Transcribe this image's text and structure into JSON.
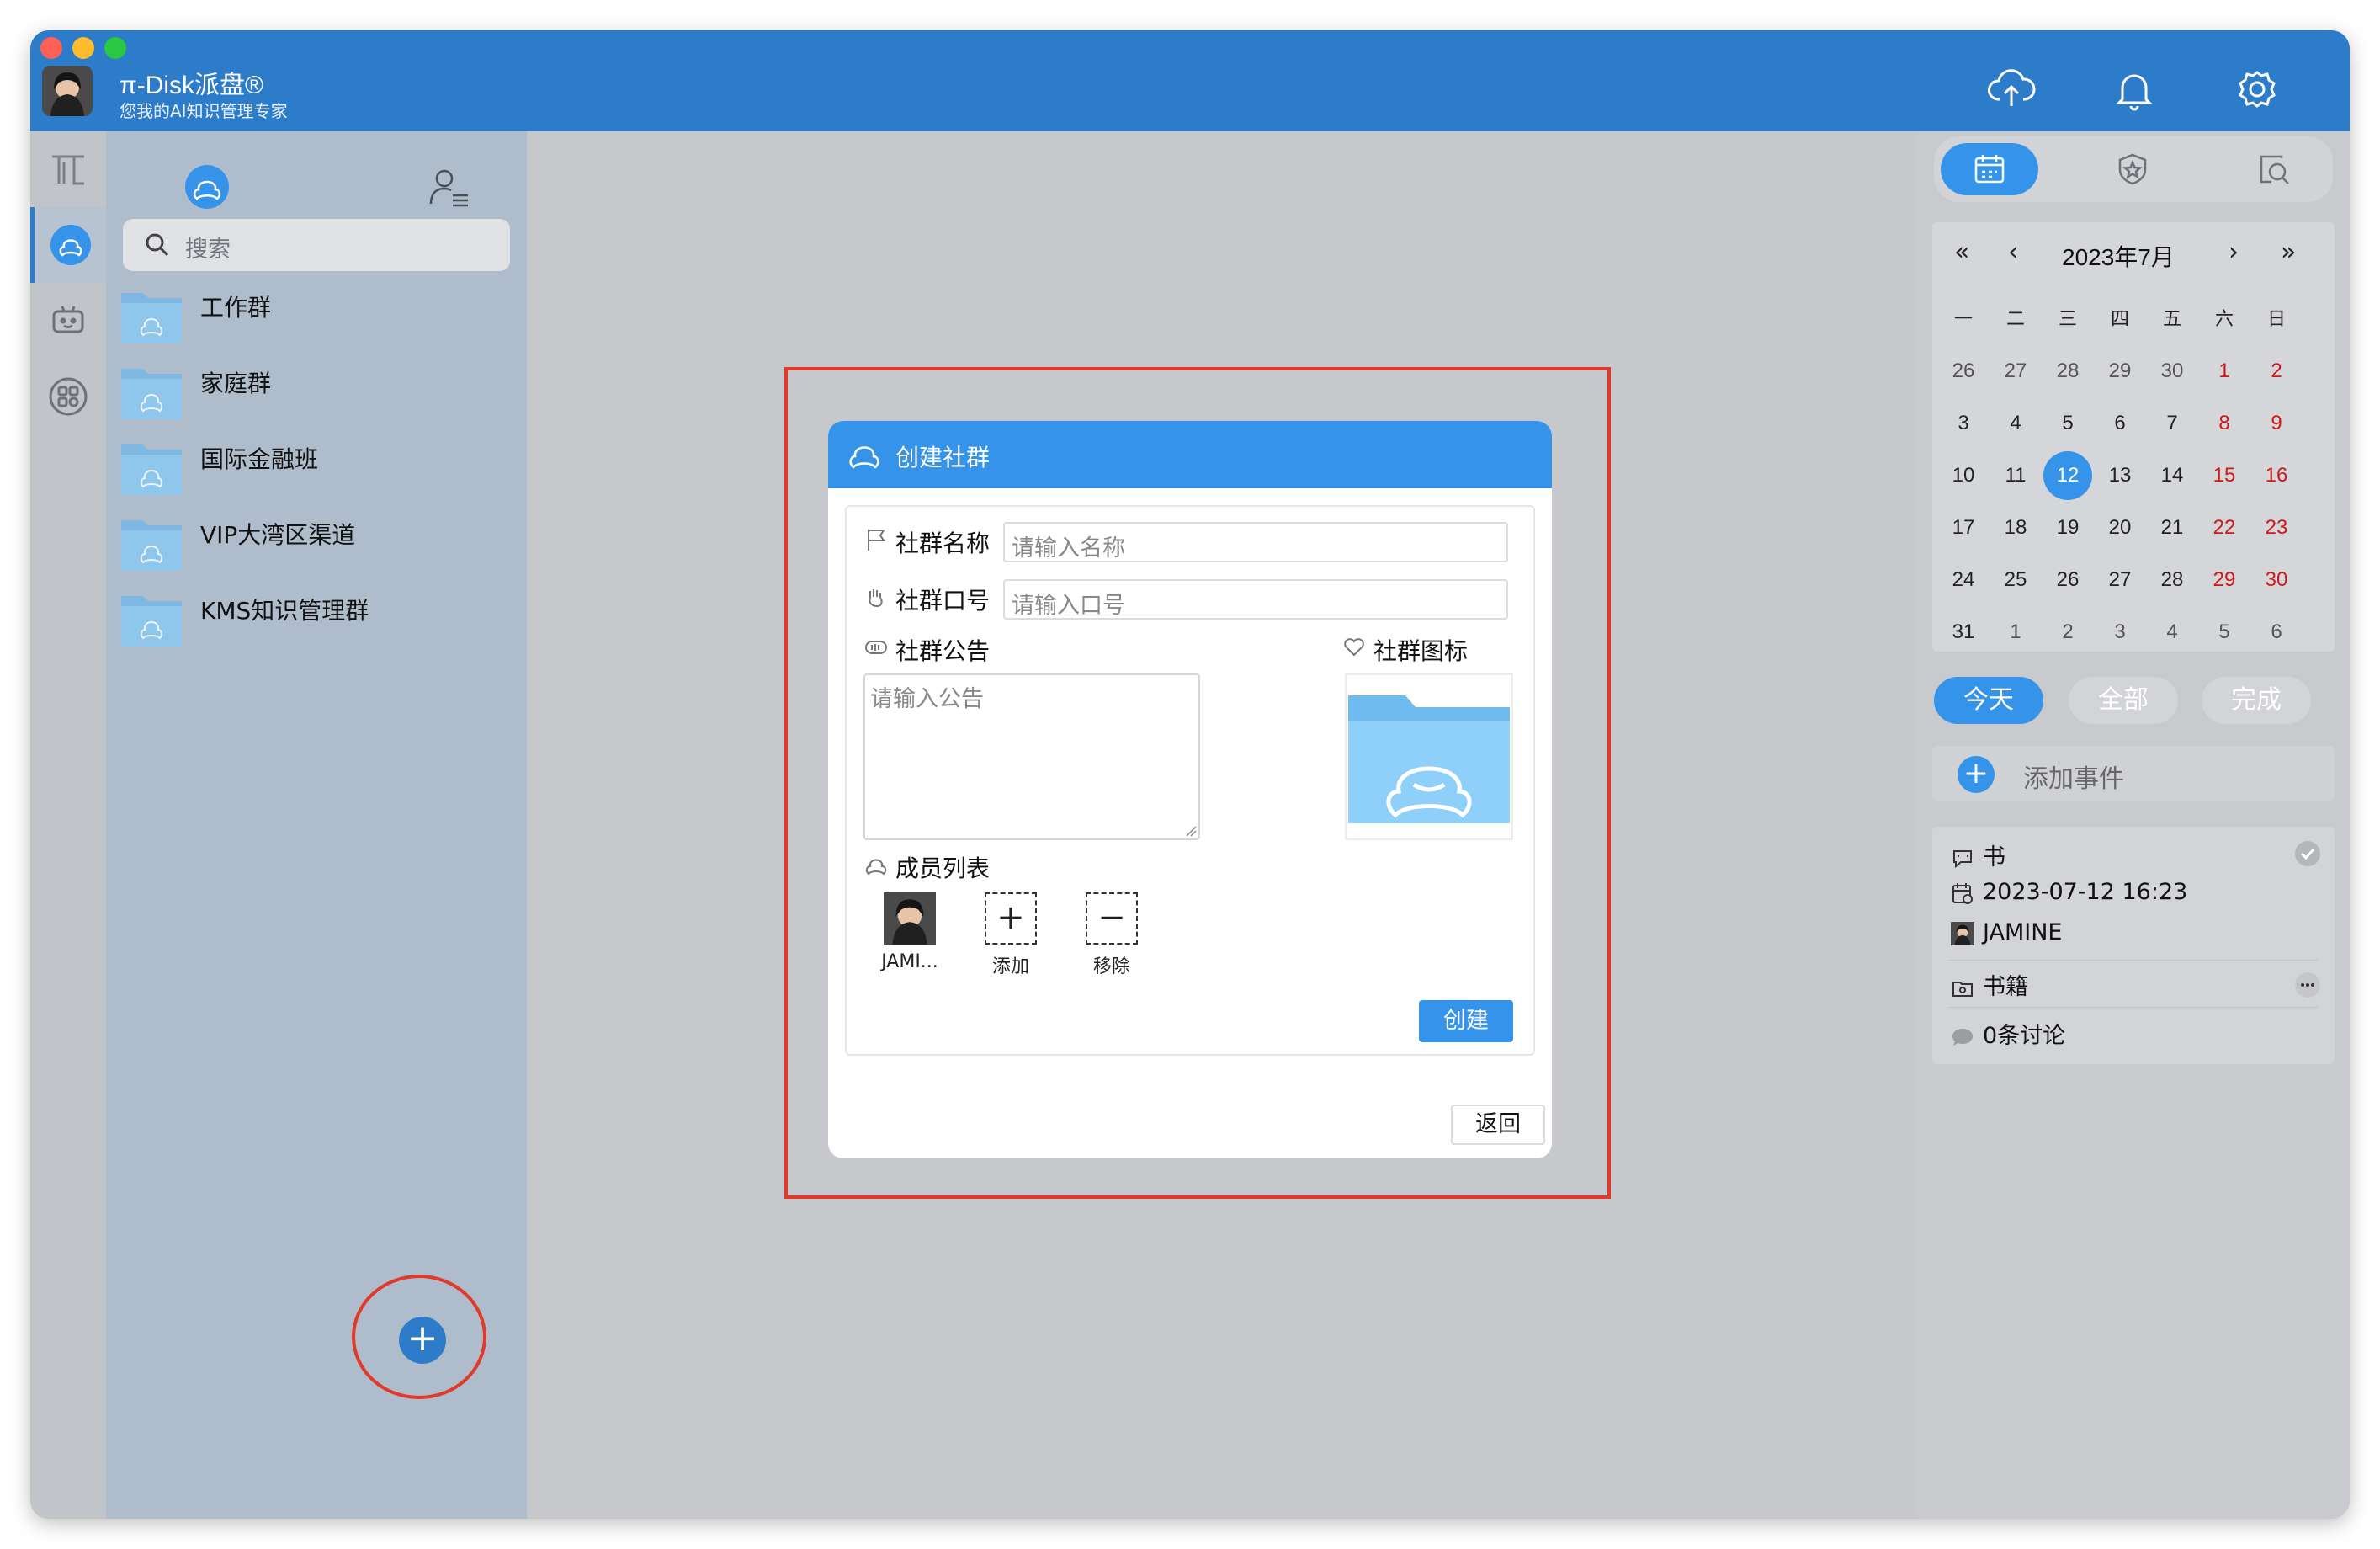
{
  "app": {
    "title": "π-Disk派盘®",
    "subtitle": "您我的AI知识管理专家"
  },
  "list": {
    "search_placeholder": "搜索",
    "groups": [
      "工作群",
      "家庭群",
      "国际金融班",
      "VIP大湾区渠道",
      "KMS知识管理群"
    ]
  },
  "dialog": {
    "title": "创建社群",
    "name_label": "社群名称",
    "name_placeholder": "请输入名称",
    "code_label": "社群口号",
    "code_placeholder": "请输入口号",
    "notice_label": "社群公告",
    "notice_placeholder": "请输入公告",
    "icon_label": "社群图标",
    "members_label": "成员列表",
    "member_name": "JAMI...",
    "add_label": "添加",
    "remove_label": "移除",
    "create_button": "创建",
    "back_button": "返回"
  },
  "calendar": {
    "month_label": "2023年7月",
    "nav": {
      "prev_year": "«",
      "prev_month": "‹",
      "next_month": "›",
      "next_year": "»"
    },
    "weekdays": [
      "一",
      "二",
      "三",
      "四",
      "五",
      "六",
      "日"
    ],
    "weeks": [
      [
        "26",
        "27",
        "28",
        "29",
        "30",
        "1",
        "2"
      ],
      [
        "3",
        "4",
        "5",
        "6",
        "7",
        "8",
        "9"
      ],
      [
        "10",
        "11",
        "12",
        "13",
        "14",
        "15",
        "16"
      ],
      [
        "17",
        "18",
        "19",
        "20",
        "21",
        "22",
        "23"
      ],
      [
        "24",
        "25",
        "26",
        "27",
        "28",
        "29",
        "30"
      ],
      [
        "31",
        "1",
        "2",
        "3",
        "4",
        "5",
        "6"
      ]
    ],
    "today": "12"
  },
  "filters": [
    "今天",
    "全部",
    "完成"
  ],
  "add_event_label": "添加事件",
  "event": {
    "title": "书",
    "datetime": "2023-07-12 16:23",
    "owner": "JAMINE",
    "folder": "书籍",
    "comments": "0条讨论"
  },
  "colors": {
    "primary": "#2d7cc9",
    "accent": "#3593ea",
    "weekend": "#d01818",
    "highlight": "#e23a2a"
  }
}
